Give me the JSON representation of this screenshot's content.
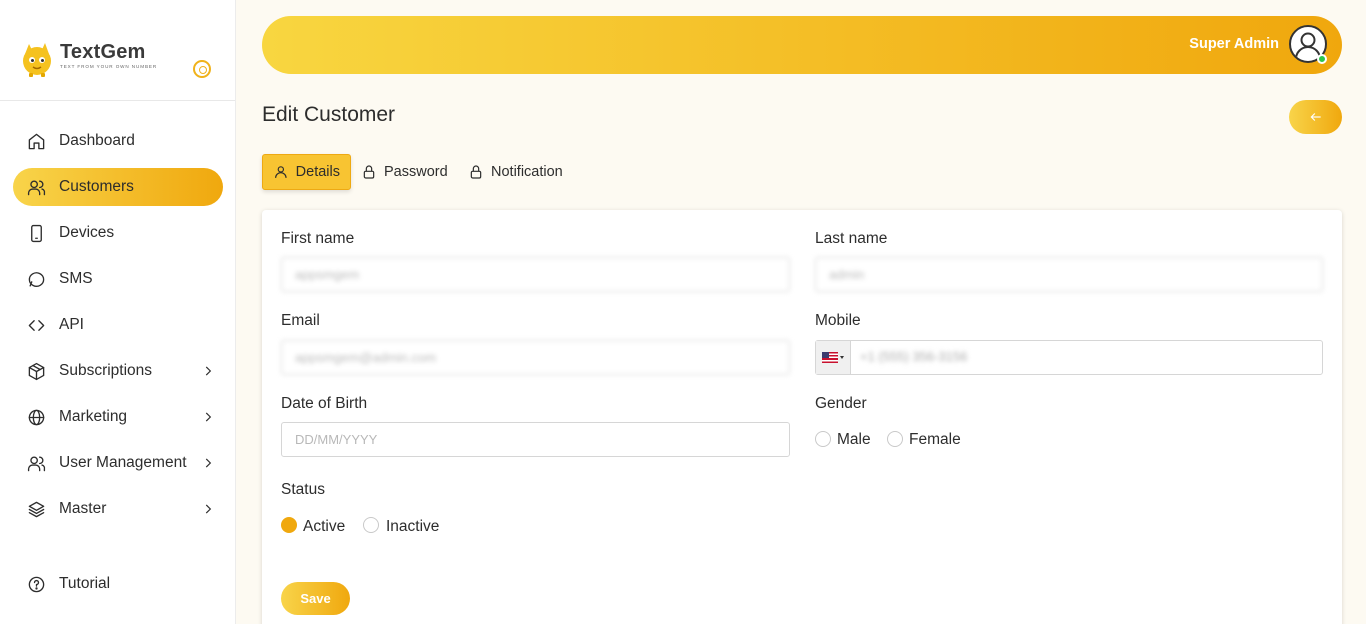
{
  "brand": {
    "name": "TextGem",
    "tagline": "TEXT FROM YOUR OWN NUMBER"
  },
  "sidebar": {
    "items": [
      {
        "label": "Dashboard",
        "icon": "home-icon",
        "active": false,
        "has_submenu": false
      },
      {
        "label": "Customers",
        "icon": "users-icon",
        "active": true,
        "has_submenu": false
      },
      {
        "label": "Devices",
        "icon": "smartphone-icon",
        "active": false,
        "has_submenu": false
      },
      {
        "label": "SMS",
        "icon": "message-circle-icon",
        "active": false,
        "has_submenu": false
      },
      {
        "label": "API",
        "icon": "code-icon",
        "active": false,
        "has_submenu": false
      },
      {
        "label": "Subscriptions",
        "icon": "package-icon",
        "active": false,
        "has_submenu": true
      },
      {
        "label": "Marketing",
        "icon": "globe-icon",
        "active": false,
        "has_submenu": true
      },
      {
        "label": "User Management",
        "icon": "users-icon",
        "active": false,
        "has_submenu": true
      },
      {
        "label": "Master",
        "icon": "layers-icon",
        "active": false,
        "has_submenu": true
      },
      {
        "label": "Tutorial",
        "icon": "help-circle-icon",
        "active": false,
        "has_submenu": false
      }
    ]
  },
  "header": {
    "user_name": "Super Admin"
  },
  "page": {
    "title": "Edit Customer",
    "tabs": [
      {
        "label": "Details",
        "icon": "user-icon",
        "active": true
      },
      {
        "label": "Password",
        "icon": "lock-icon",
        "active": false
      },
      {
        "label": "Notification",
        "icon": "lock-icon",
        "active": false
      }
    ]
  },
  "form": {
    "first_name": {
      "label": "First name",
      "value": "appsmgem"
    },
    "last_name": {
      "label": "Last name",
      "value": "admin"
    },
    "email": {
      "label": "Email",
      "value": "appsmgem@admin.com"
    },
    "mobile": {
      "label": "Mobile",
      "value": "+1 (555) 356-3156",
      "country": "US"
    },
    "dob": {
      "label": "Date of Birth",
      "placeholder": "DD/MM/YYYY",
      "value": ""
    },
    "gender": {
      "label": "Gender",
      "options": [
        "Male",
        "Female"
      ],
      "selected": null
    },
    "status": {
      "label": "Status",
      "options": [
        "Active",
        "Inactive"
      ],
      "selected": "Active"
    },
    "save_label": "Save"
  },
  "colors": {
    "accent_start": "#f8d44a",
    "accent_end": "#f0a80e",
    "online": "#2ec74a"
  }
}
